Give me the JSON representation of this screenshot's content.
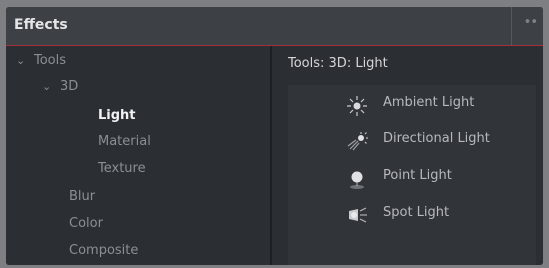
{
  "panel": {
    "title": "Effects",
    "more_label": "••"
  },
  "tree": {
    "items": [
      {
        "label": "Tools",
        "chevron": "⌄"
      },
      {
        "label": "3D",
        "chevron": "⌄"
      },
      {
        "label": "Light"
      },
      {
        "label": "Material"
      },
      {
        "label": "Texture"
      },
      {
        "label": "Blur"
      },
      {
        "label": "Color"
      },
      {
        "label": "Composite"
      }
    ]
  },
  "content": {
    "title": "Tools: 3D: Light",
    "items": [
      {
        "label": "Ambient Light",
        "icon": "ambient-light-icon"
      },
      {
        "label": "Directional Light",
        "icon": "directional-light-icon"
      },
      {
        "label": "Point Light",
        "icon": "point-light-icon"
      },
      {
        "label": "Spot Light",
        "icon": "spot-light-icon"
      }
    ]
  },
  "colors": {
    "accent": "#a3313a",
    "panel_bg": "#2b2e32",
    "header_bg": "#3d4045"
  }
}
